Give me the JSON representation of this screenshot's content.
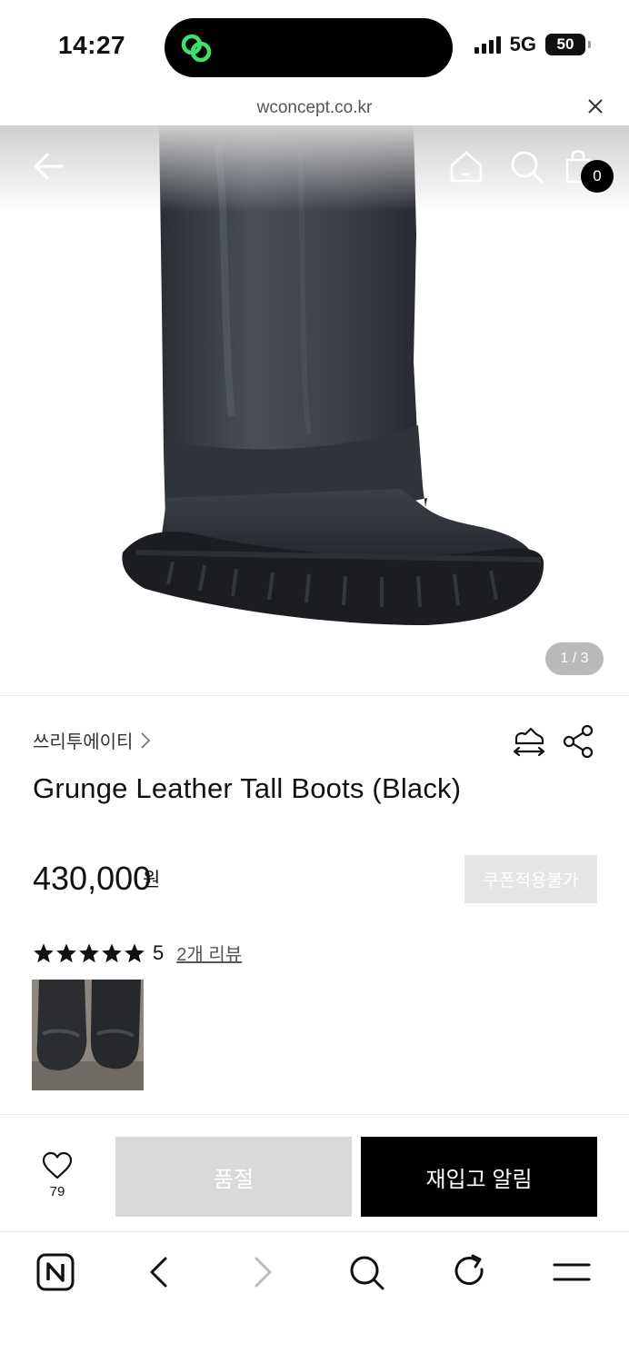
{
  "status_bar": {
    "time": "14:27",
    "network": "5G",
    "battery": "50"
  },
  "url_bar": {
    "domain": "wconcept.co.kr"
  },
  "hero": {
    "cart_count": "0",
    "page_indicator": "1 / 3"
  },
  "product": {
    "brand": "쓰리투에이티",
    "title": "Grunge Leather Tall Boots (Black)",
    "price": "430,000",
    "price_unit": "원",
    "coupon_label": "쿠폰적용불가",
    "rating": {
      "stars": 5,
      "score": "5",
      "review_link": "2개 리뷰"
    }
  },
  "purchase_bar": {
    "wish_count": "79",
    "soldout_label": "품절",
    "restock_label": "재입고 알림"
  },
  "icons": {
    "header": [
      "back-arrow-icon",
      "home-icon",
      "search-icon",
      "shopping-bag-icon"
    ],
    "product": [
      "chevron-right-icon",
      "size-guide-icon",
      "share-icon",
      "star-icon",
      "heart-icon"
    ],
    "toolbar": [
      "naver-n-icon",
      "back-icon",
      "forward-icon",
      "search-icon",
      "refresh-icon",
      "menu-icon"
    ]
  }
}
